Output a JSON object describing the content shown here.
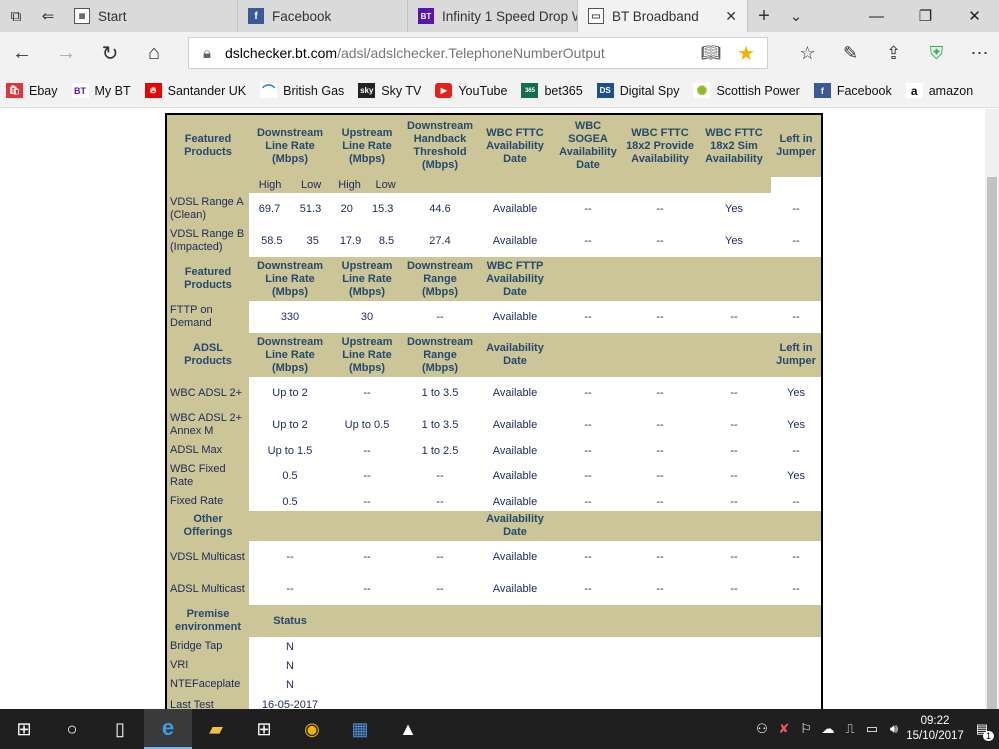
{
  "tabs": [
    {
      "label": "Start",
      "icon": "start-icon"
    },
    {
      "label": "Facebook",
      "icon": "facebook-icon"
    },
    {
      "label": "Infinity 1 Speed Drop W",
      "icon": "bt-icon"
    },
    {
      "label": "BT Broadband",
      "icon": "page-icon",
      "active": true
    }
  ],
  "address": {
    "host": "dslchecker.bt.com",
    "path": "/adsl/adslchecker.TelephoneNumberOutput"
  },
  "favorites": [
    {
      "label": "Ebay",
      "icon": "ebay-icon"
    },
    {
      "label": "My BT",
      "icon": "bt-icon"
    },
    {
      "label": "Santander UK",
      "icon": "santander-icon"
    },
    {
      "label": "British Gas",
      "icon": "britishgas-icon"
    },
    {
      "label": "Sky TV",
      "icon": "sky-icon"
    },
    {
      "label": "YouTube",
      "icon": "youtube-icon"
    },
    {
      "label": "bet365",
      "icon": "bet365-icon"
    },
    {
      "label": "Digital Spy",
      "icon": "ds-icon"
    },
    {
      "label": "Scottish Power",
      "icon": "scottishpower-icon"
    },
    {
      "label": "Facebook",
      "icon": "facebook-icon"
    },
    {
      "label": "amazon",
      "icon": "amazon-icon"
    }
  ],
  "vdsl": {
    "headers": [
      "Featured Products",
      "Downstream Line Rate (Mbps)",
      "Upstream Line Rate (Mbps)",
      "Downstream Handback Threshold (Mbps)",
      "WBC FTTC Availability Date",
      "WBC SOGEA Availability Date",
      "WBC FTTC 18x2 Provide Availability",
      "WBC FTTC 18x2 Sim Availability",
      "Left in Jumper"
    ],
    "sub": {
      "high": "High",
      "low": "Low"
    },
    "rows": [
      {
        "name": "VDSL Range A (Clean)",
        "dhigh": "69.7",
        "dlow": "51.3",
        "uhigh": "20",
        "ulow": "15.3",
        "thr": "44.6",
        "fttc": "Available",
        "sogea": "--",
        "p18": "--",
        "s18": "Yes",
        "lij": "--"
      },
      {
        "name": "VDSL Range B (Impacted)",
        "dhigh": "58.5",
        "dlow": "35",
        "uhigh": "17.9",
        "ulow": "8.5",
        "thr": "27.4",
        "fttc": "Available",
        "sogea": "--",
        "p18": "--",
        "s18": "Yes",
        "lij": "--"
      }
    ]
  },
  "fttp": {
    "headers": [
      "Featured Products",
      "Downstream Line Rate (Mbps)",
      "Upstream Line Rate (Mbps)",
      "Downstream Range (Mbps)",
      "WBC FTTP Availability Date"
    ],
    "rows": [
      {
        "name": "FTTP on Demand",
        "down": "330",
        "up": "30",
        "range": "--",
        "avail": "Available",
        "c5": "--",
        "c6": "--",
        "c7": "--",
        "c8": "--"
      }
    ]
  },
  "adsl": {
    "headers": [
      "ADSL Products",
      "Downstream Line Rate (Mbps)",
      "Upstream Line Rate (Mbps)",
      "Downstream Range (Mbps)",
      "Availability Date",
      "Left in Jumper"
    ],
    "rows": [
      {
        "name": "WBC ADSL 2+",
        "down": "Up to 2",
        "up": "--",
        "range": "1 to 3.5",
        "avail": "Available",
        "c5": "--",
        "c6": "--",
        "c7": "--",
        "lij": "Yes"
      },
      {
        "name": "WBC ADSL 2+ Annex M",
        "down": "Up to 2",
        "up": "Up to 0.5",
        "range": "1 to 3.5",
        "avail": "Available",
        "c5": "--",
        "c6": "--",
        "c7": "--",
        "lij": "Yes"
      },
      {
        "name": "ADSL Max",
        "down": "Up to 1.5",
        "up": "--",
        "range": "1 to 2.5",
        "avail": "Available",
        "c5": "--",
        "c6": "--",
        "c7": "--",
        "lij": "--"
      },
      {
        "name": "WBC Fixed Rate",
        "down": "0.5",
        "up": "--",
        "range": "--",
        "avail": "Available",
        "c5": "--",
        "c6": "--",
        "c7": "--",
        "lij": "Yes"
      },
      {
        "name": "Fixed Rate",
        "down": "0.5",
        "up": "--",
        "range": "--",
        "avail": "Available",
        "c5": "--",
        "c6": "--",
        "c7": "--",
        "lij": "--"
      }
    ]
  },
  "other": {
    "headers": [
      "Other Offerings",
      "Availability Date"
    ],
    "rows": [
      {
        "name": "VDSL Multicast",
        "c1": "--",
        "c2": "--",
        "c3": "--",
        "avail": "Available",
        "c5": "--",
        "c6": "--",
        "c7": "--",
        "c8": "--"
      },
      {
        "name": "ADSL Multicast",
        "c1": "--",
        "c2": "--",
        "c3": "--",
        "avail": "Available",
        "c5": "--",
        "c6": "--",
        "c7": "--",
        "c8": "--"
      }
    ]
  },
  "premise": {
    "headers": [
      "Premise environment",
      "Status"
    ],
    "rows": [
      {
        "name": "Bridge Tap",
        "status": "N"
      },
      {
        "name": "VRI",
        "status": "N"
      },
      {
        "name": "NTEFaceplate",
        "status": "N"
      },
      {
        "name": "Last Test",
        "status": "16-05-2017"
      }
    ]
  },
  "clock": {
    "time": "09:22",
    "date": "15/10/2017"
  },
  "notification_count": "1",
  "colors": {
    "header_bg": "#ccc597",
    "header_text": "#254a6e",
    "cell_text": "#1b2b5b",
    "taskbar": "#1f1f1f"
  }
}
